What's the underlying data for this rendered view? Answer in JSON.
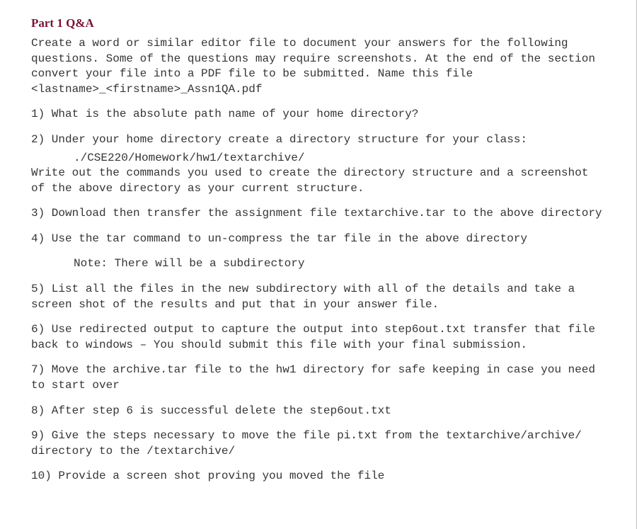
{
  "title": "Part 1 Q&A",
  "intro": "Create a word or similar editor file to document your answers for the following questions. Some of the questions may require screenshots. At the end of the section convert your file into a PDF file to be submitted. Name this file <lastname>_<firstname>_Assn1QA.pdf",
  "q1": "1) What is the absolute path name of your home directory?",
  "q2": "2) Under your home directory create a directory structure for your class:",
  "q2_path": "./CSE220/Homework/hw1/textarchive/",
  "q2_after": "Write out the commands you used to create the directory structure and a screenshot of the above directory as your current structure.",
  "q3": "3) Download then transfer the assignment file textarchive.tar to the above directory",
  "q4": "4) Use the tar command to un-compress the tar file in the above directory",
  "q4_note": "Note: There will be a subdirectory",
  "q5": "5) List all the files in the new subdirectory with all of the details and take a screen shot of the results and put that in your answer file.",
  "q6": "6) Use redirected output to capture the output into step6out.txt transfer that file back to windows – You should submit this file with your final submission.",
  "q7": "7) Move the archive.tar file to the hw1 directory for safe keeping in case you need to start over",
  "q8": "8) After step 6 is successful delete the step6out.txt",
  "q9": "9) Give the steps necessary to move the file pi.txt from the textarchive/archive/ directory to the /textarchive/",
  "q10": "10) Provide a screen shot proving you moved the file"
}
